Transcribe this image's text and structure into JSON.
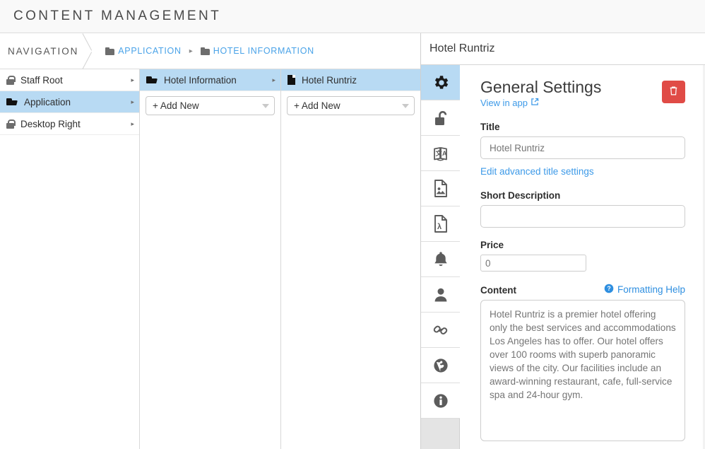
{
  "header": {
    "title": "CONTENT MANAGEMENT"
  },
  "breadcrumb": {
    "nav_label": "NAVIGATION",
    "separator": "▸",
    "items": [
      {
        "label": "APPLICATION",
        "icon": "folder-icon"
      },
      {
        "label": "HOTEL INFORMATION",
        "icon": "folder-icon"
      }
    ]
  },
  "columns": {
    "nav": {
      "items": [
        {
          "label": "Staff Root",
          "icon": "lock-icon",
          "caret": "▸",
          "selected": false
        },
        {
          "label": "Application",
          "icon": "folder-open-icon",
          "caret": "▸",
          "selected": true
        },
        {
          "label": "Desktop Right",
          "icon": "lock-icon",
          "caret": "▸",
          "selected": false
        }
      ]
    },
    "second": {
      "item": {
        "label": "Hotel Information",
        "icon": "folder-open-icon",
        "caret": "▸",
        "selected": true
      },
      "add_new_label": "+ Add New"
    },
    "third": {
      "item": {
        "label": "Hotel Runtriz",
        "icon": "file-icon",
        "caret": "",
        "selected": true
      },
      "add_new_label": "+ Add New"
    }
  },
  "right_panel": {
    "title": "Hotel Runtriz",
    "rail": [
      {
        "name": "gear-icon",
        "active": true
      },
      {
        "name": "unlock-icon",
        "active": false
      },
      {
        "name": "translate-icon",
        "active": false
      },
      {
        "name": "image-file-icon",
        "active": false
      },
      {
        "name": "pdf-file-icon",
        "active": false
      },
      {
        "name": "bell-icon",
        "active": false
      },
      {
        "name": "user-icon",
        "active": false
      },
      {
        "name": "link-icon",
        "active": false
      },
      {
        "name": "globe-icon",
        "active": false
      },
      {
        "name": "info-icon",
        "active": false
      }
    ],
    "section_title": "General Settings",
    "view_in_app_label": "View in app",
    "delete_button_label": "",
    "fields": {
      "title": {
        "label": "Title",
        "value": "Hotel Runtriz",
        "placeholder": "Hotel Runtriz",
        "advanced_link": "Edit advanced title settings"
      },
      "short_description": {
        "label": "Short Description",
        "value": "",
        "placeholder": ""
      },
      "price": {
        "label": "Price",
        "value": "0",
        "placeholder": "0"
      },
      "content": {
        "label": "Content",
        "formatting_help_label": "Formatting Help",
        "value": "Hotel Runtriz is a premier hotel offering only the best services and accommodations Los Angeles has to offer. Our hotel offers over 100 rooms with superb panoramic views of the city. Our facilities include an award-winning restaurant, cafe, full-service spa and 24-hour gym.",
        "placeholder": ""
      }
    }
  },
  "colors": {
    "accent_blue": "#3d9ae8",
    "selection_blue": "#b8daf3",
    "danger_red": "#e04b46",
    "header_bg": "#f9f9f9",
    "rail_bg": "#e4e4e4"
  }
}
